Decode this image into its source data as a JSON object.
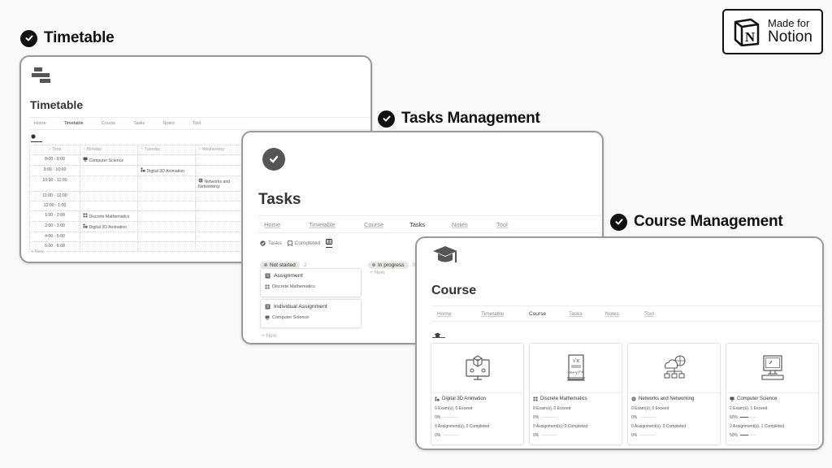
{
  "headings": {
    "timetable": "Timetable",
    "tasks": "Tasks Management",
    "course": "Course Management"
  },
  "badge": {
    "line1": "Made for",
    "line2": "Notion"
  },
  "nav_items": [
    "Home",
    "Timetable",
    "Course",
    "Tasks",
    "Notes",
    "Tool"
  ],
  "timetable": {
    "page_icon": "timetable-blocks-icon",
    "title": "Timetable",
    "active_nav": "Timetable",
    "columns": [
      "Time",
      "Monday",
      "Tuesday",
      "Wednesday"
    ],
    "rows": [
      {
        "time": "8:00 - 9:00",
        "monday": "Computer Science",
        "tuesday": "",
        "wednesday": ""
      },
      {
        "time": "9:00 - 10:00",
        "monday": "",
        "tuesday": "Digital 3D Animation",
        "wednesday": ""
      },
      {
        "time": "10:00 - 11:00",
        "monday": "",
        "tuesday": "",
        "wednesday": "Networks and Networking"
      },
      {
        "time": "11:00 - 12:00",
        "monday": "",
        "tuesday": "",
        "wednesday": ""
      },
      {
        "time": "12:00 - 1:00",
        "monday": "",
        "tuesday": "",
        "wednesday": ""
      },
      {
        "time": "1:00 - 2:00",
        "monday": "Discrete Mathematics",
        "tuesday": "",
        "wednesday": ""
      },
      {
        "time": "2:00 - 3:00",
        "monday": "Digital 3D Animation",
        "tuesday": "",
        "wednesday": ""
      },
      {
        "time": "4:00 - 5:00",
        "monday": "",
        "tuesday": "",
        "wednesday": ""
      },
      {
        "time": "5:00 - 6:00",
        "monday": "",
        "tuesday": "",
        "wednesday": ""
      }
    ],
    "new_label": "+ New"
  },
  "tasks": {
    "page_icon": "check-circle-icon",
    "title": "Tasks",
    "active_nav": "Tasks",
    "view_tabs": [
      "Tasks",
      "Completed"
    ],
    "columns": [
      {
        "status": "Not started",
        "count": "2",
        "cards": [
          {
            "title": "Assignment",
            "course": "Discrete Mathematics"
          },
          {
            "title": "Individual Assignment",
            "course": "Computer Science"
          }
        ],
        "new_label": "+ New"
      },
      {
        "status": "In progress",
        "count": "0",
        "cards": [],
        "new_label": "+ New"
      }
    ]
  },
  "course": {
    "page_icon": "graduation-cap-icon",
    "title": "Course",
    "active_nav": "Course",
    "cards": [
      {
        "name": "Digital 3D Animation",
        "exams": "0 Exam(s), 0 Exceed",
        "exam_pct": "0%",
        "exam_progress": 0,
        "assignments": "0 Assignment(s), 0 Completed",
        "assign_pct": "0%",
        "assign_progress": 0
      },
      {
        "name": "Discrete Mathematics",
        "exams": "0 Exam(s), 0 Exceed",
        "exam_pct": "0%",
        "exam_progress": 0,
        "assignments": "0 Assignment(s), 0 Completed",
        "assign_pct": "0%",
        "assign_progress": 0
      },
      {
        "name": "Networks and Networking",
        "exams": "0 Exam(s), 0 Exceed",
        "exam_pct": "0%",
        "exam_progress": 0,
        "assignments": "0 Assignment(s), 0 Completed",
        "assign_pct": "0%",
        "assign_progress": 0
      },
      {
        "name": "Computer Science",
        "exams": "2 Exam(s), 1 Exceed",
        "exam_pct": "50%",
        "exam_progress": 0.5,
        "assignments": "2 Assignment(s), 1 Completed",
        "assign_pct": "50%",
        "assign_progress": 0.5
      }
    ]
  }
}
